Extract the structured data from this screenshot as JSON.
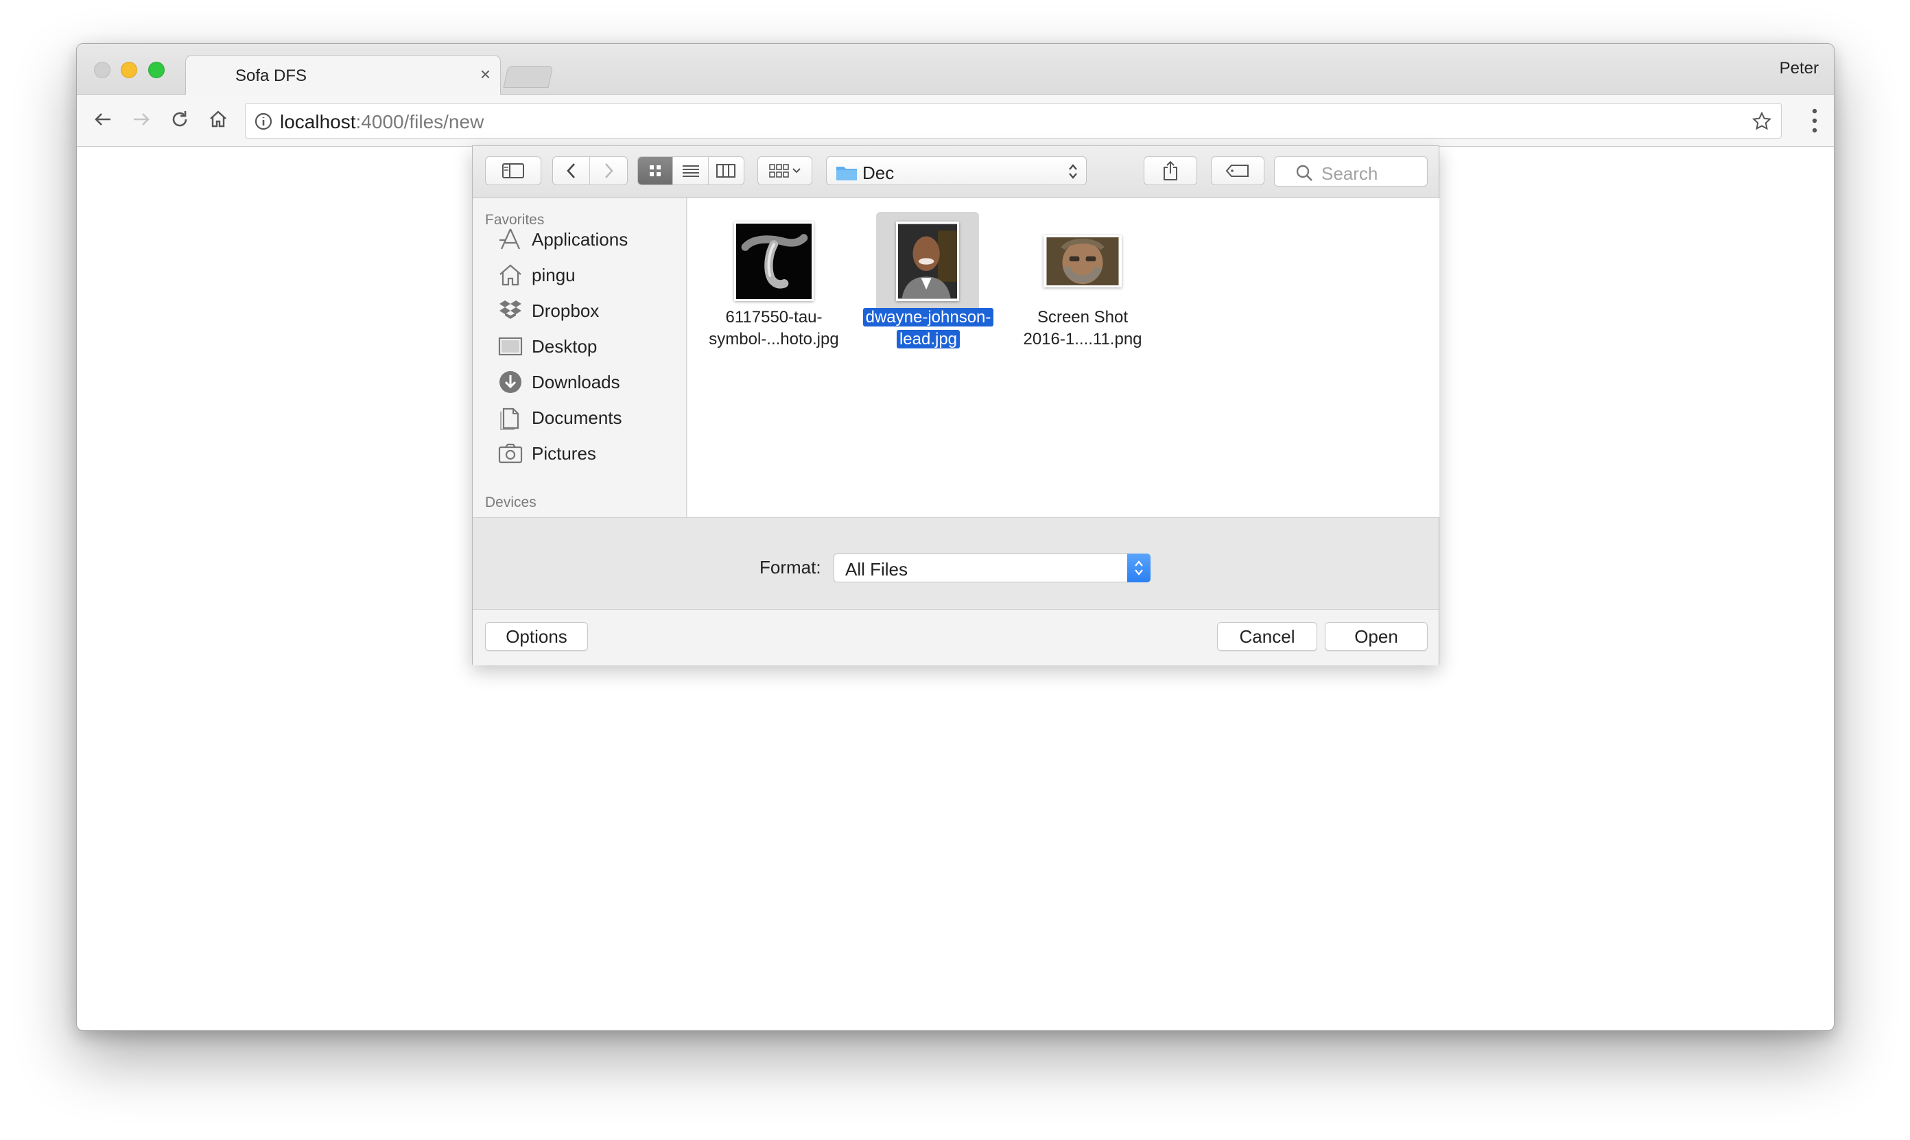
{
  "browser": {
    "tab_title": "Sofa DFS",
    "tab_close": "×",
    "profile_name": "Peter",
    "url_host": "localhost",
    "url_path": ":4000/files/new"
  },
  "dialog": {
    "location": "Dec",
    "search_placeholder": "Search",
    "sidebar": {
      "favorites_heading": "Favorites",
      "items": [
        {
          "label": "Applications",
          "icon": "applications-icon"
        },
        {
          "label": "pingu",
          "icon": "home-icon"
        },
        {
          "label": "Dropbox",
          "icon": "dropbox-icon"
        },
        {
          "label": "Desktop",
          "icon": "desktop-icon"
        },
        {
          "label": "Downloads",
          "icon": "downloads-icon"
        },
        {
          "label": "Documents",
          "icon": "documents-icon"
        },
        {
          "label": "Pictures",
          "icon": "pictures-icon"
        }
      ],
      "devices_heading": "Devices"
    },
    "files": [
      {
        "line1": "6117550-tau-",
        "line2": "symbol-...hoto.jpg",
        "selected": false
      },
      {
        "line1": "dwayne-johnson-",
        "line2": "lead.jpg",
        "selected": true
      },
      {
        "line1": "Screen Shot",
        "line2": "2016-1....11.png",
        "selected": false
      }
    ],
    "format_label": "Format:",
    "format_value": "All Files",
    "options_label": "Options",
    "cancel_label": "Cancel",
    "open_label": "Open"
  },
  "colors": {
    "selection": "#1d63d8",
    "stepper": "#2a7ff2",
    "folder": "#5fb0f0"
  }
}
